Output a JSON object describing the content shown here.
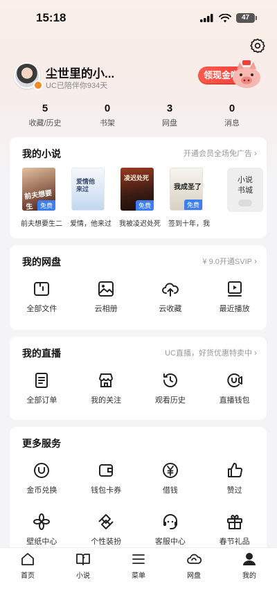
{
  "status_bar": {
    "time": "15:18",
    "battery": "47"
  },
  "profile": {
    "username": "尘世里的小...",
    "days": "UC已陪伴你934天",
    "gold_button": "领现金啦"
  },
  "stats": [
    {
      "value": "5",
      "label": "收藏/历史"
    },
    {
      "value": "0",
      "label": "书架"
    },
    {
      "value": "3",
      "label": "网盘"
    },
    {
      "value": "0",
      "label": "消息"
    }
  ],
  "novels_card": {
    "title": "我的小说",
    "extra": "开通会员全场免广告",
    "books": [
      {
        "title": "前夫想要生二",
        "cover_text": "前夫想要生",
        "tag": "免费",
        "colors": [
          "#7a4a3a",
          "#e3c2a0"
        ]
      },
      {
        "title": "爱情，他来过",
        "cover_text": "爱情他来过",
        "tag": "",
        "colors": [
          "#d9e6f5",
          "#f6f8fb"
        ]
      },
      {
        "title": "我被凌迟处死",
        "cover_text": "凌迟处死",
        "tag": "免费",
        "colors": [
          "#3a1b14",
          "#9a3b22"
        ]
      },
      {
        "title": "签到十年，我",
        "cover_text": "我成圣了",
        "tag": "免费",
        "colors": [
          "#f4f1ea",
          "#d8d2c4"
        ]
      }
    ],
    "city_label_1": "小说",
    "city_label_2": "书城"
  },
  "cloud_card": {
    "title": "我的网盘",
    "extra": "¥ 9.0开通SVIP",
    "items": [
      {
        "label": "全部文件",
        "icon": "folder-icon"
      },
      {
        "label": "云相册",
        "icon": "photo-album-icon"
      },
      {
        "label": "云收藏",
        "icon": "cloud-upload-icon"
      },
      {
        "label": "最近播放",
        "icon": "recent-play-icon"
      }
    ]
  },
  "live_card": {
    "title": "我的直播",
    "extra": "UC直播，好货优惠特卖中",
    "items": [
      {
        "label": "全部订单",
        "icon": "order-icon"
      },
      {
        "label": "我的关注",
        "icon": "shop-icon"
      },
      {
        "label": "观看历史",
        "icon": "history-icon"
      },
      {
        "label": "直播钱包",
        "icon": "live-wallet-icon"
      }
    ]
  },
  "services_card": {
    "title": "更多服务",
    "row1": [
      {
        "label": "金币兑换",
        "icon": "coin-icon"
      },
      {
        "label": "钱包卡券",
        "icon": "wallet-icon"
      },
      {
        "label": "借钱",
        "icon": "yen-icon"
      },
      {
        "label": "赞过",
        "icon": "thumbs-up-icon"
      }
    ],
    "row2": [
      {
        "label": "壁纸中心",
        "icon": "wallpaper-icon"
      },
      {
        "label": "个性装扮",
        "icon": "theme-icon"
      },
      {
        "label": "客服中心",
        "icon": "customer-service-icon"
      },
      {
        "label": "春节礼品",
        "icon": "gift-icon"
      }
    ]
  },
  "tabbar": [
    {
      "label": "首页",
      "icon": "home-icon"
    },
    {
      "label": "小说",
      "icon": "book-icon"
    },
    {
      "label": "菜单",
      "icon": "menu-icon"
    },
    {
      "label": "网盘",
      "icon": "cloud-icon"
    },
    {
      "label": "我的",
      "icon": "profile-icon"
    }
  ],
  "colors": {
    "accent_blue": "#3d7ff2",
    "gold_red": "#f0413a",
    "card_bg": "#ffffff",
    "page_bg": "#f4f4f6"
  }
}
